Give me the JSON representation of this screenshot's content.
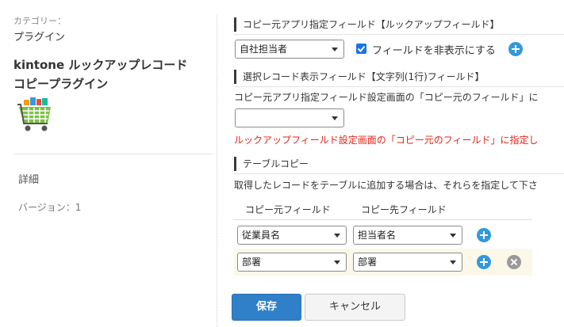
{
  "plugin": {
    "category_label": "カテゴリー：",
    "category_value": "プラグイン",
    "title_line1": "kintone ルックアップレコード",
    "title_line2": "コピープラグイン",
    "icon": "shopping-cart-icon",
    "detail_label": "詳細",
    "version_label": "バージョン：1"
  },
  "section_lookup": {
    "heading": "コピー元アプリ指定フィールド【ルックアップフィールド】",
    "selected_field": "自社担当者",
    "hide_checkbox_checked": true,
    "hide_checkbox_label": "フィールドを非表示にする"
  },
  "section_display": {
    "heading": "選択レコード表示フィールド【文字列(1行)フィールド】",
    "description": "コピー元アプリ指定フィールド設定画面の「コピー元のフィールド」に",
    "selected_field": "",
    "warning": "ルックアップフィールド設定画面の「コピー元のフィールド」に指定し"
  },
  "section_table": {
    "heading": "テーブルコピー",
    "description": "取得したレコードをテーブルに追加する場合は、それらを指定して下さ",
    "col_source": "コピー元フィールド",
    "col_dest": "コピー先フィールド",
    "rows": [
      {
        "source": "従業員名",
        "dest": "担当者名",
        "removable": false
      },
      {
        "source": "部署",
        "dest": "部署",
        "removable": true
      }
    ]
  },
  "buttons": {
    "save": "保存",
    "cancel": "キャンセル"
  },
  "colors": {
    "accent": "#3498db",
    "primary_button": "#2f80c9",
    "warning_text": "#e0261a",
    "row_highlight": "#fbf8ea"
  }
}
